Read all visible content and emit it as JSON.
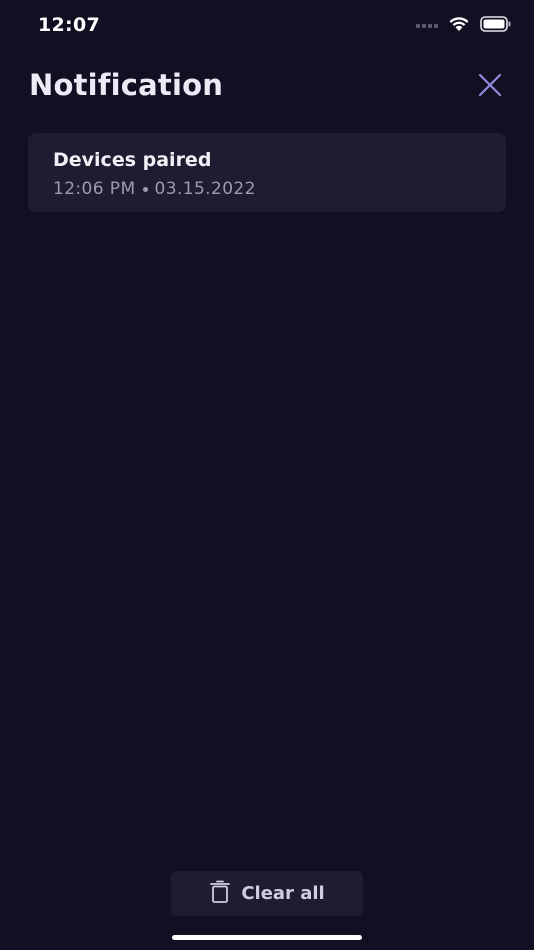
{
  "status_bar": {
    "time": "12:07",
    "icons": [
      "cellular-signal-icon",
      "wifi-icon",
      "battery-icon"
    ]
  },
  "header": {
    "title": "Notification",
    "close_icon": "close-icon"
  },
  "notifications": [
    {
      "title": "Devices paired",
      "time": "12:06 PM",
      "date": "03.15.2022"
    }
  ],
  "footer": {
    "clear_all_label": "Clear all",
    "clear_all_icon": "trash-icon"
  },
  "colors": {
    "background": "#120f22",
    "card": "#1f1c31",
    "accent": "#8f8ce0",
    "primary_text": "#ecebf5",
    "secondary_text": "#9d9ab0"
  }
}
